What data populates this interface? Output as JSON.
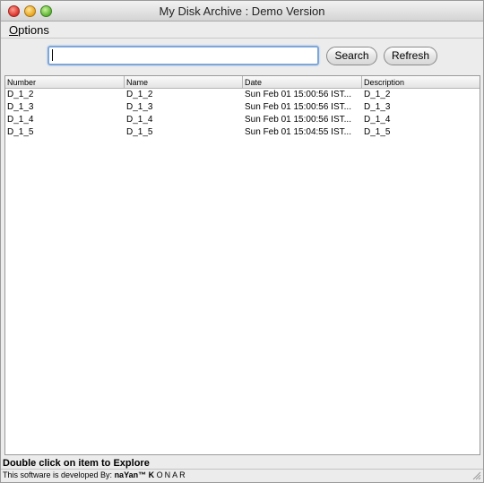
{
  "window": {
    "title": "My Disk Archive : Demo Version"
  },
  "menu": {
    "options_mnemonic": "O",
    "options_rest": "ptions"
  },
  "search": {
    "value": "",
    "search_label": "Search",
    "refresh_label": "Refresh"
  },
  "table": {
    "headers": [
      "Number",
      "Name",
      "Date",
      "Description"
    ],
    "rows": [
      [
        "D_1_2",
        "D_1_2",
        "Sun Feb 01 15:00:56 IST...",
        "D_1_2"
      ],
      [
        "D_1_3",
        "D_1_3",
        "Sun Feb 01 15:00:56 IST...",
        "D_1_3"
      ],
      [
        "D_1_4",
        "D_1_4",
        "Sun Feb 01 15:00:56 IST...",
        "D_1_4"
      ],
      [
        "D_1_5",
        "D_1_5",
        "Sun Feb 01 15:04:55 IST...",
        "D_1_5"
      ]
    ]
  },
  "status": {
    "hint": "Double click on item to Explore",
    "credit_prefix": "This software is developed By: ",
    "credit_name": "naYan™ ",
    "credit_k": "K",
    "credit_rest": "ONAR"
  },
  "icons": {
    "close": "close-icon",
    "minimize": "minimize-icon",
    "maximize": "maximize-icon",
    "resize": "resize-grip-icon"
  }
}
